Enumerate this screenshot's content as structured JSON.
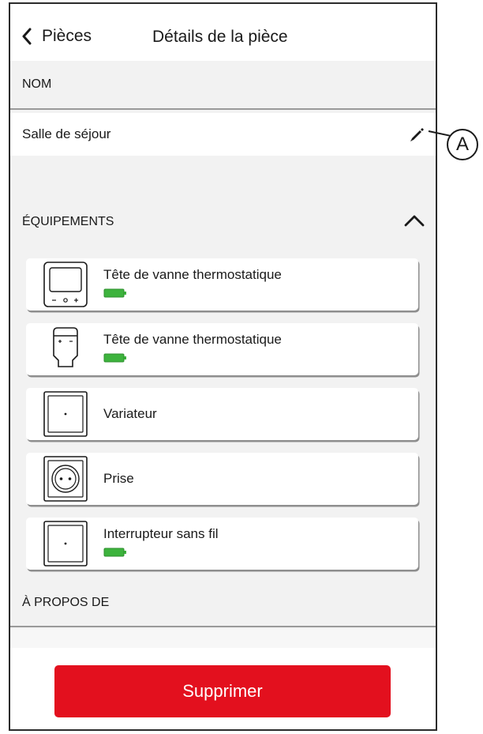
{
  "header": {
    "back_label": "Pièces",
    "title": "Détails de la pièce"
  },
  "name_section": {
    "label": "NOM",
    "value": "Salle de séjour"
  },
  "equipment_section": {
    "label": "ÉQUIPEMENTS",
    "items": [
      {
        "name": "Tête de vanne thermostatique",
        "icon": "thermostat-display-icon",
        "battery_level": 1.0
      },
      {
        "name": "Tête de vanne thermostatique",
        "icon": "radiator-valve-icon",
        "battery_level": 1.0
      },
      {
        "name": "Variateur",
        "icon": "dimmer-switch-icon"
      },
      {
        "name": "Prise",
        "icon": "socket-outlet-icon"
      },
      {
        "name": "Interrupteur sans fil",
        "icon": "wireless-switch-icon",
        "battery_level": 1.0
      }
    ]
  },
  "about_section": {
    "label": "À PROPOS DE"
  },
  "footer": {
    "delete_label": "Supprimer"
  },
  "callout": {
    "letter": "A"
  },
  "colors": {
    "delete_button": "#e3101e",
    "battery_full": "#3db33d",
    "background": "#f2f2f2"
  }
}
